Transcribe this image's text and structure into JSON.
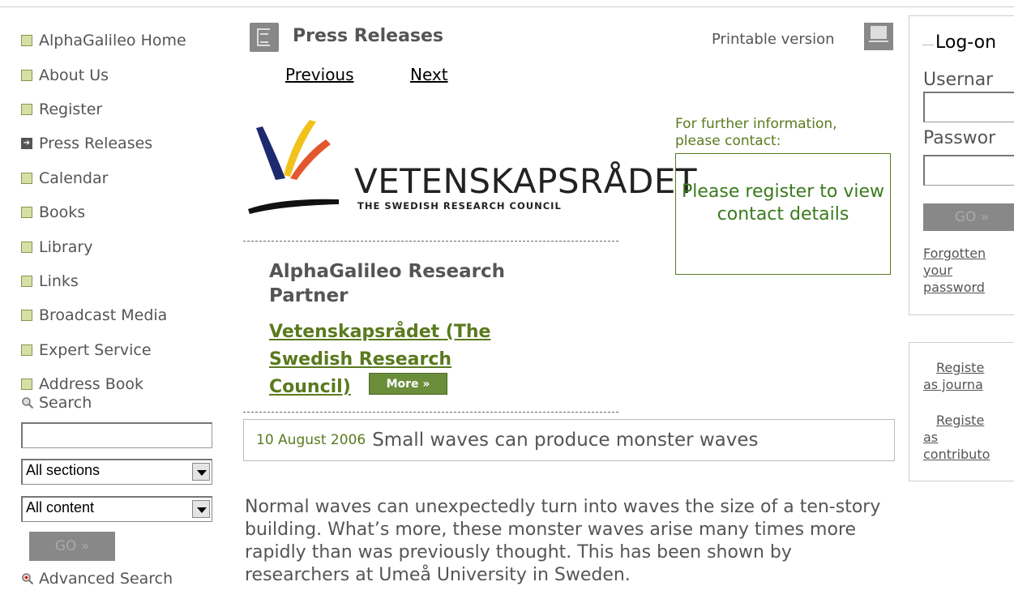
{
  "nav": {
    "items": [
      {
        "label": "AlphaGalileo Home",
        "icon": "square-bullet-icon"
      },
      {
        "label": "About Us",
        "icon": "square-bullet-icon"
      },
      {
        "label": "Register",
        "icon": "square-bullet-icon"
      },
      {
        "label": "Press Releases",
        "icon": "arrow-right-icon"
      },
      {
        "label": "Calendar",
        "icon": "square-bullet-icon"
      },
      {
        "label": "Books",
        "icon": "square-bullet-icon"
      },
      {
        "label": "Library",
        "icon": "square-bullet-icon"
      },
      {
        "label": "Links",
        "icon": "square-bullet-icon"
      },
      {
        "label": "Broadcast Media",
        "icon": "square-bullet-icon"
      },
      {
        "label": "Expert Service",
        "icon": "square-bullet-icon"
      },
      {
        "label": "Address Book",
        "icon": "square-bullet-icon"
      }
    ]
  },
  "search": {
    "label": "Search",
    "value": "",
    "sections_selected": "All sections",
    "content_selected": "All content",
    "go_label": "GO  »",
    "advanced_label": "Advanced Search"
  },
  "header": {
    "section_title": "Press Releases",
    "printable_label": "Printable version",
    "previous_label": "Previous",
    "next_label": "Next"
  },
  "logo": {
    "wordmark": "VETENSKAPSRÅDET",
    "subtitle": "THE SWEDISH RESEARCH COUNCIL"
  },
  "partner": {
    "title": "AlphaGalileo Research Partner",
    "link": "Vetenskapsrådet (The Swedish Research Council)",
    "more_label": "More »"
  },
  "contact": {
    "label": "For further information, please contact:",
    "box_text": "Please register to view contact details"
  },
  "article": {
    "date": "10 August 2006",
    "headline": "Small waves can produce monster waves",
    "body": "Normal waves can unexpectedly turn into waves the size of a ten-story building. What’s more, these monster waves arise many times more rapidly than was previously thought. This has been shown by researchers at Umeå University in Sweden."
  },
  "login": {
    "legend": "Log-on",
    "username_label": "Usernar",
    "password_label": "Passwor",
    "go_label": "GO  »",
    "forgotten_label": "Forgotten your password",
    "register_journalist_label": "Registe as journa",
    "register_contributor_label": "Registe as contributo"
  },
  "colors": {
    "accent_green": "#5a7a1e",
    "button_gray": "#888888",
    "text_gray": "#555555"
  }
}
